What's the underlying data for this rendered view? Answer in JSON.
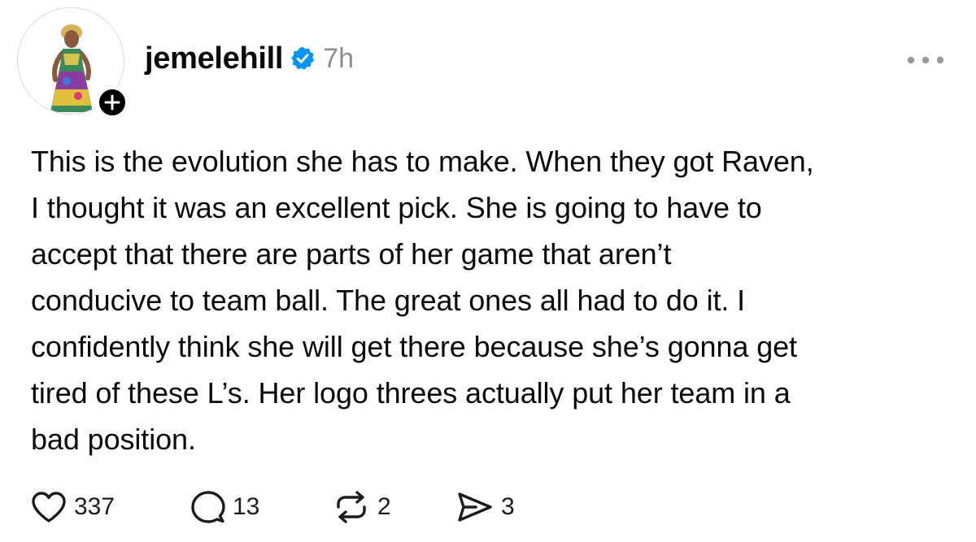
{
  "post": {
    "author": {
      "username": "jemelehill",
      "verified": true,
      "timestamp": "7h",
      "follow_symbol": "+"
    },
    "text": "This is the evolution she has to make. When they got Raven,\nI thought it was an excellent pick. She is going to have to\naccept that there are parts of her game that aren’t\nconducive to team ball. The great ones all had to do it. I\nconfidently think she will get there because she’s gonna get\ntired of these L’s. Her logo threes actually put her team in a\nbad position.",
    "actions": {
      "likes": "337",
      "replies": "13",
      "reposts": "2",
      "shares": "3"
    },
    "icons": {
      "more": "more-horizontal-icon",
      "like": "heart-icon",
      "reply": "speech-bubble-icon",
      "repost": "repost-arrows-icon",
      "share": "send-icon",
      "verified": "verified-badge-icon"
    }
  },
  "colors": {
    "verified_blue": "#0095f6",
    "text": "#0a0a0a",
    "muted": "#8e8e8e",
    "background": "#ffffff"
  }
}
